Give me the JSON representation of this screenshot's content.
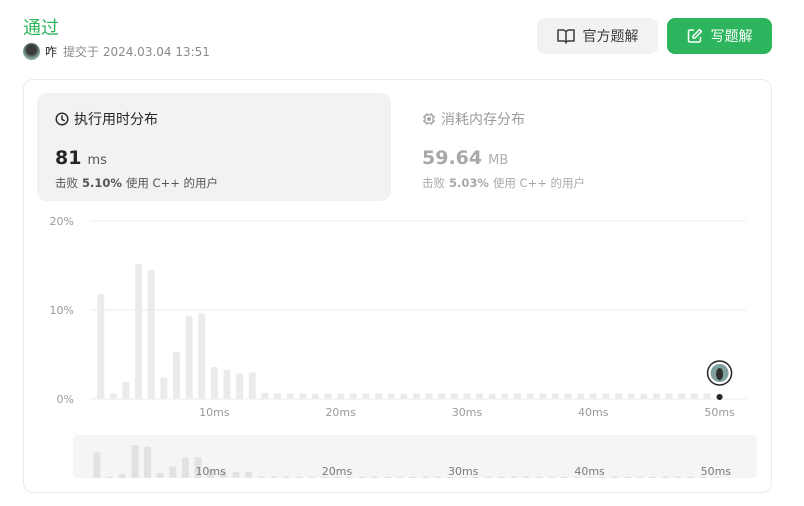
{
  "header": {
    "status": "通过",
    "username": "咋",
    "submitted_label": "提交于 2024.03.04 13:51",
    "official_solution_label": "官方题解",
    "write_solution_label": "写题解"
  },
  "tabs": {
    "runtime": {
      "title": "执行用时分布",
      "value": "81",
      "unit": "ms",
      "beats_prefix": "击败",
      "beats_pct": "5.10%",
      "beats_suffix": "使用 C++ 的用户"
    },
    "memory": {
      "title": "消耗内存分布",
      "value": "59.64",
      "unit": "MB",
      "beats_prefix": "击败",
      "beats_pct": "5.03%",
      "beats_suffix": "使用 C++ 的用户"
    }
  },
  "colors": {
    "accent": "#2db55d",
    "bar": "#ebebeb"
  },
  "chart_data": {
    "type": "bar",
    "ylim": [
      0,
      20
    ],
    "yticks": [
      "20%",
      "10%",
      "0%"
    ],
    "ytick_values": [
      20,
      10,
      0
    ],
    "xticks": [
      "10ms",
      "20ms",
      "30ms",
      "40ms",
      "50ms"
    ],
    "xtick_values": [
      10,
      20,
      30,
      40,
      50
    ],
    "x": [
      1,
      2,
      3,
      4,
      5,
      6,
      7,
      8,
      9,
      10,
      11,
      12,
      13,
      14,
      15,
      16,
      17,
      18,
      19,
      20,
      21,
      22,
      23,
      24,
      25,
      26,
      27,
      28,
      29,
      30,
      31,
      32,
      33,
      34,
      35,
      36,
      37,
      38,
      39,
      40,
      41,
      42,
      43,
      44,
      45,
      46,
      47,
      48,
      49,
      50
    ],
    "values": [
      11.8,
      0.6,
      1.9,
      15.2,
      14.5,
      2.4,
      5.3,
      9.3,
      9.6,
      3.6,
      3.3,
      2.9,
      3.0,
      0.7,
      0.6,
      0.6,
      0.6,
      0.6,
      0.6,
      0.6,
      0.6,
      0.6,
      0.6,
      0.6,
      0.6,
      0.6,
      0.6,
      0.6,
      0.6,
      0.6,
      0.6,
      0.6,
      0.6,
      0.6,
      0.6,
      0.6,
      0.6,
      0.6,
      0.6,
      0.6,
      0.6,
      0.6,
      0.6,
      0.6,
      0.6,
      0.6,
      0.6,
      0.6,
      0.6,
      0.6
    ],
    "user_value_x": 50,
    "grid": true
  }
}
